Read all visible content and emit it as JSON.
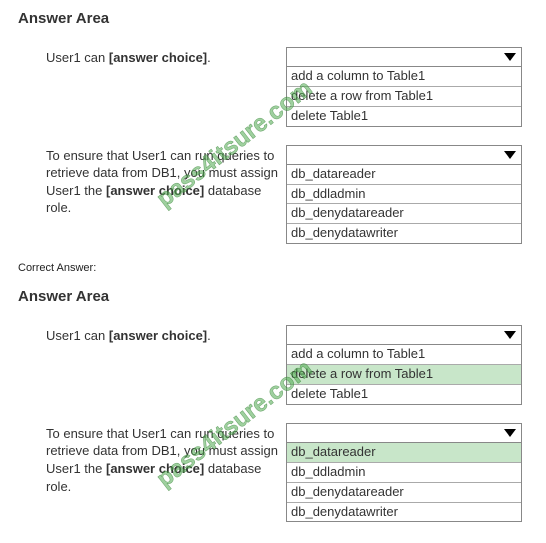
{
  "watermark": "pass4itsure.com",
  "header": "Answer Area",
  "correct_label": "Correct Answer:",
  "q1": {
    "prompt_pre": "User1 can ",
    "prompt_bold": "[answer choice]",
    "prompt_post": ".",
    "options": [
      "add a column to Table1",
      "delete a row from Table1",
      "delete Table1"
    ]
  },
  "q2": {
    "prompt_pre": "To ensure that User1 can run queries to retrieve data from DB1, you must assign User1 the ",
    "prompt_bold": "[answer choice]",
    "prompt_post": " database role.",
    "options": [
      "db_datareader",
      "db_ddladmin",
      "db_denydatareader",
      "db_denydatawriter"
    ]
  },
  "answers": {
    "q1_selected_index": 1,
    "q2_selected_index": 0
  }
}
